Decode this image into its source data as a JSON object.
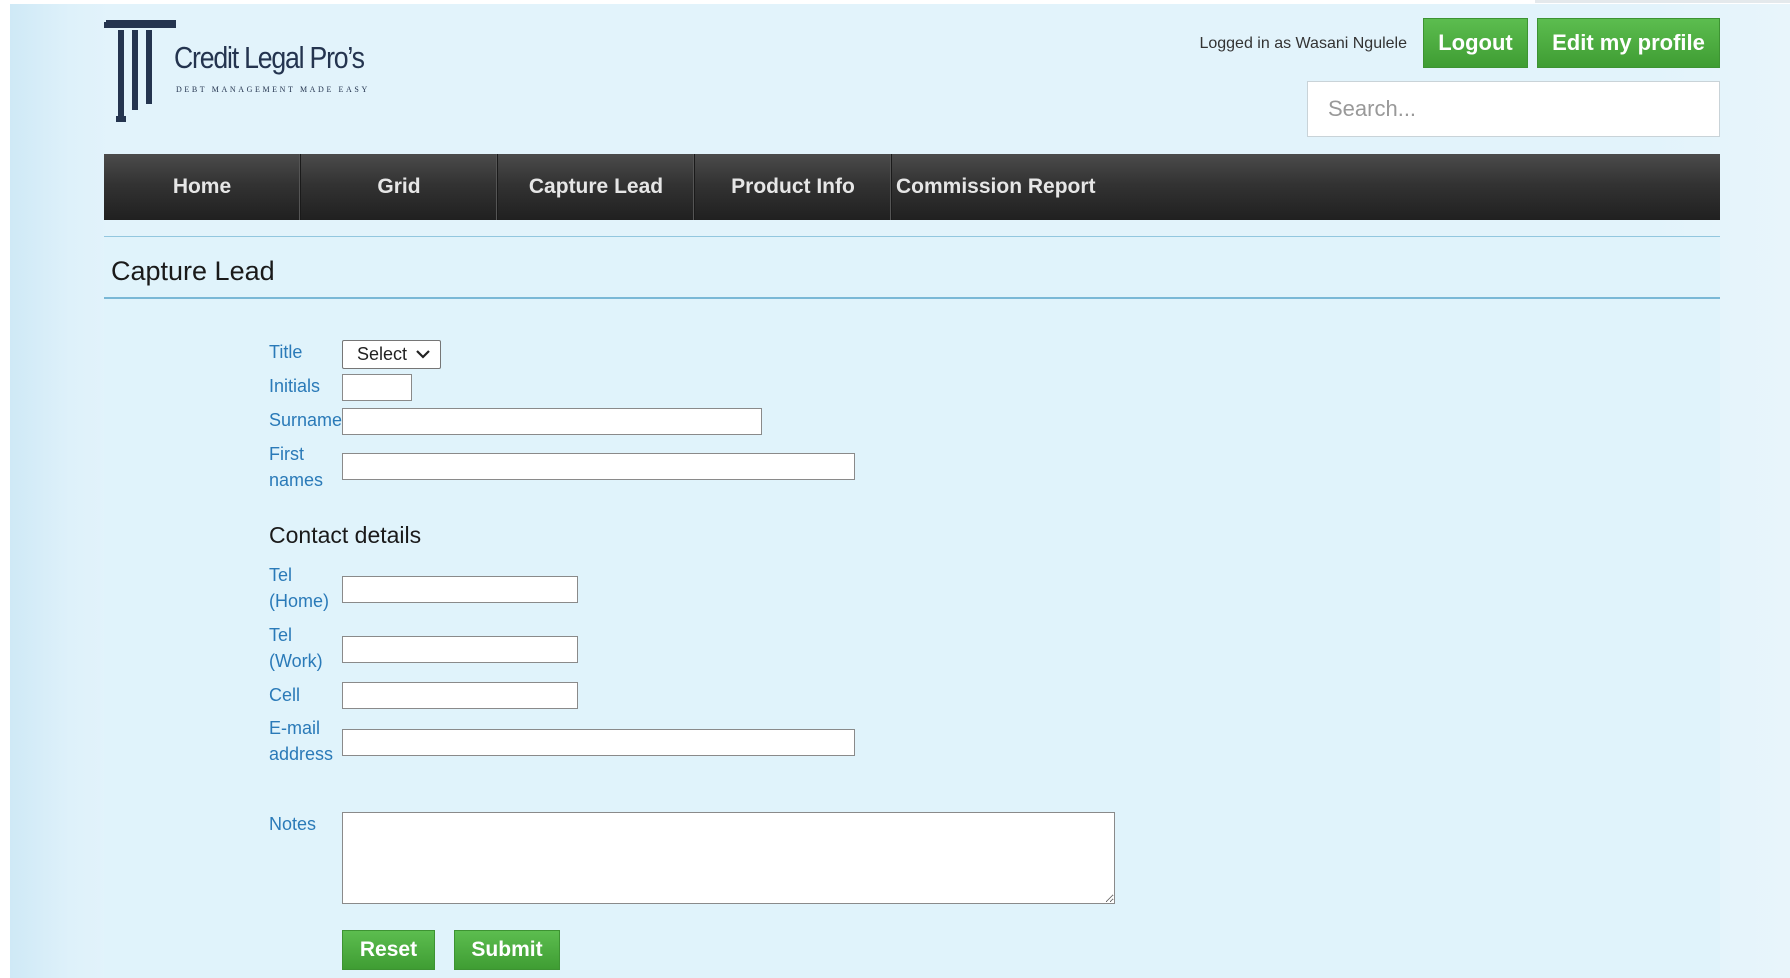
{
  "brand": {
    "name": "Credit Legal Pro’s",
    "tagline": "DEBT MANAGEMENT MADE EASY"
  },
  "header": {
    "user_info": "Logged in as Wasani Ngulele",
    "logout_label": "Logout",
    "edit_profile_label": "Edit my profile",
    "search_placeholder": "Search..."
  },
  "nav": {
    "items": [
      {
        "label": "Home"
      },
      {
        "label": "Grid"
      },
      {
        "label": "Capture Lead"
      },
      {
        "label": "Product Info"
      },
      {
        "label": "Commission Report"
      }
    ]
  },
  "page": {
    "title": "Capture Lead"
  },
  "form": {
    "title_label": "Title",
    "title_value": "Select",
    "initials_label": "Initials",
    "surname_label": "Surname",
    "first_names_label": "First names",
    "contact_heading": "Contact details",
    "tel_home_label": "Tel (Home)",
    "tel_work_label": "Tel (Work)",
    "cell_label": "Cell",
    "email_label": "E-mail address",
    "notes_label": "Notes",
    "reset_label": "Reset",
    "submit_label": "Submit"
  },
  "colors": {
    "background": "#e0f3fb",
    "navbar": "#2e2e2e",
    "button_green": "#4cae3f",
    "label_blue": "#2a7ab8",
    "rule_blue": "#7ab8d6"
  },
  "icons": {
    "logo": "pillar-logo-icon",
    "select": "chevron-down-icon"
  }
}
